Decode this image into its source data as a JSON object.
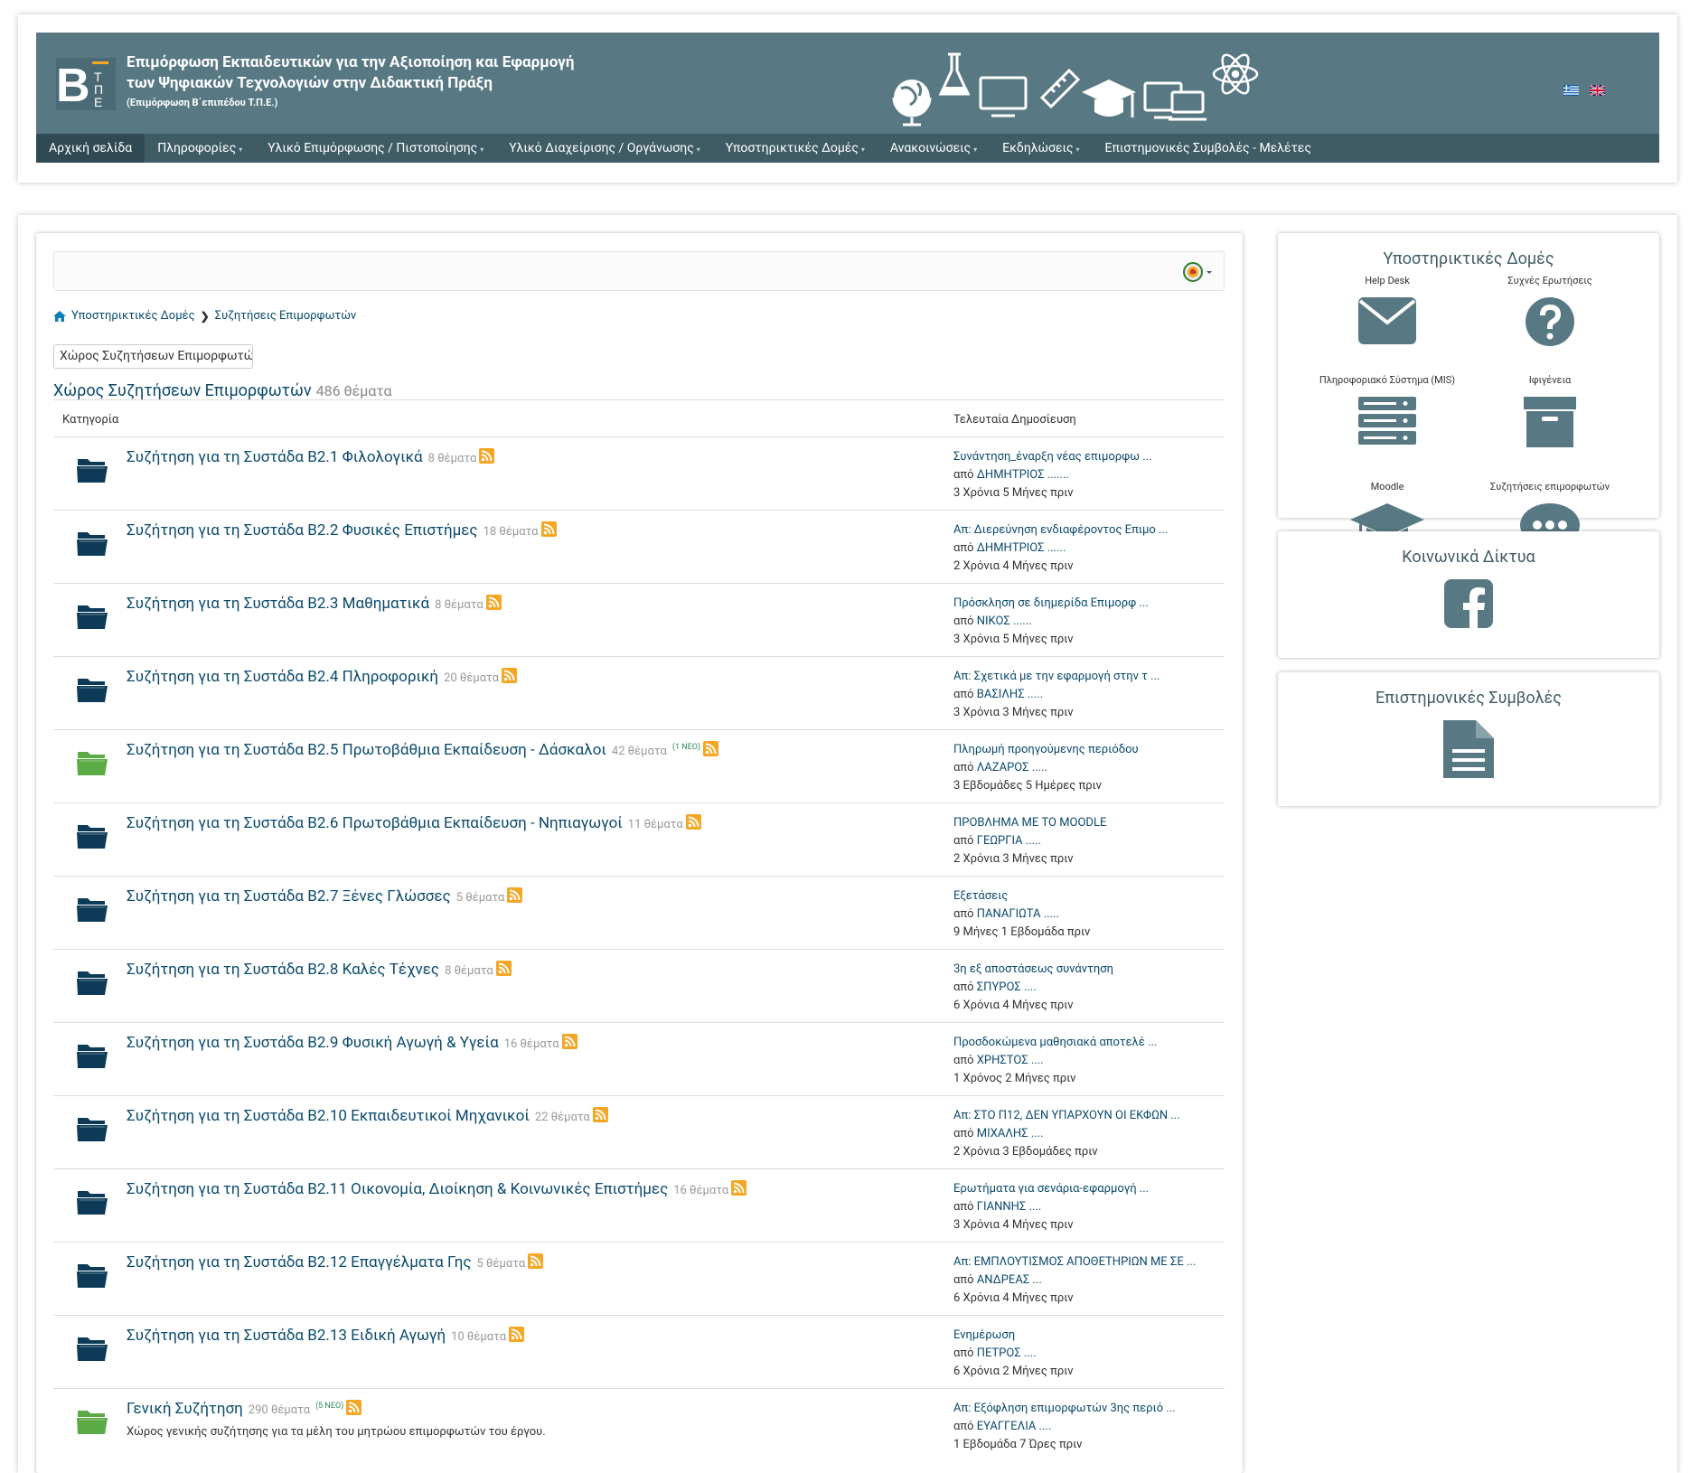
{
  "header": {
    "title_line1": "Επιμόρφωση Εκπαιδευτικών για την Αξιοποίηση και Εφαρμογή",
    "title_line2": "των Ψηφιακών Τεχνολογιών στην Διδακτική Πράξη",
    "subtitle": "(Επιμόρφωση Β΄επιπέδου Τ.Π.Ε.)",
    "logo_text": "B",
    "banner_color": "#587983",
    "nav_color": "#3f5c65"
  },
  "nav": [
    {
      "label": "Αρχική σελίδα",
      "dropdown": false
    },
    {
      "label": "Πληροφορίες",
      "dropdown": true
    },
    {
      "label": "Υλικό Επιμόρφωσης / Πιστοποίησης",
      "dropdown": true
    },
    {
      "label": "Υλικό Διαχείρισης / Οργάνωσης",
      "dropdown": true
    },
    {
      "label": "Υποστηρικτικές Δομές",
      "dropdown": true
    },
    {
      "label": "Ανακοινώσεις",
      "dropdown": true
    },
    {
      "label": "Εκδηλώσεις",
      "dropdown": true
    },
    {
      "label": "Επιστημονικές Συμβολές - Μελέτες",
      "dropdown": false
    }
  ],
  "breadcrumb": {
    "item1": "Υποστηρικτικές Δομές",
    "item2": "Συζητήσεις Επιμορφωτών"
  },
  "forum_select": "Χώρος Συζητήσεων Επιμορφωτών",
  "forum": {
    "title": "Χώρος Συζητήσεων Επιμορφωτών",
    "count": "486 θέματα",
    "col_category": "Κατηγορία",
    "col_last": "Τελευταία Δημοσίευση"
  },
  "categories": [
    {
      "title": "Συζήτηση για τη Συστάδα Β2.1 Φιλολογικά",
      "count": "8 θέματα",
      "new": "",
      "desc": "",
      "last_title": "Συνάντηση_έναρξη νέας επιμορφω ...",
      "by": "από",
      "author": "ΔΗΜΗΤΡΙΟΣ .......",
      "time": "3 Χρόνια 5 Μήνες πριν",
      "has_new": false
    },
    {
      "title": "Συζήτηση για τη Συστάδα Β2.2 Φυσικές Επιστήμες",
      "count": "18 θέματα",
      "new": "",
      "desc": "",
      "last_title": "Απ: Διερεύνηση ενδιαφέροντος Επιμο ...",
      "by": "από",
      "author": "ΔΗΜΗΤΡΙΟΣ ......",
      "time": "2 Χρόνια 4 Μήνες πριν",
      "has_new": false
    },
    {
      "title": "Συζήτηση για τη Συστάδα Β2.3 Μαθηματικά",
      "count": "8 θέματα",
      "new": "",
      "desc": "",
      "last_title": "Πρόσκληση σε διημερίδα Επιμορφ ...",
      "by": "από",
      "author": "ΝΙΚΟΣ ......",
      "time": "3 Χρόνια 5 Μήνες πριν",
      "has_new": false
    },
    {
      "title": "Συζήτηση για τη Συστάδα Β2.4 Πληροφορική",
      "count": "20 θέματα",
      "new": "",
      "desc": "",
      "last_title": "Απ: Σχετικά με την εφαρμογή στην τ ...",
      "by": "από",
      "author": "ΒΑΣΙΛΗΣ .....",
      "time": "3 Χρόνια 3 Μήνες πριν",
      "has_new": false
    },
    {
      "title": "Συζήτηση για τη Συστάδα Β2.5 Πρωτοβάθμια Εκπαίδευση - Δάσκαλοι",
      "count": "42 θέματα",
      "new": "(1 ΝΕΟ)",
      "desc": "",
      "last_title": "Πληρωμή προηγούμενης περιόδου",
      "by": "από",
      "author": "ΛΑΖΑΡΟΣ .....",
      "time": "3 Εβδομάδες 5 Ημέρες πριν",
      "has_new": true
    },
    {
      "title": "Συζήτηση για τη Συστάδα Β2.6 Πρωτοβάθμια Εκπαίδευση - Νηπιαγωγοί",
      "count": "11 θέματα",
      "new": "",
      "desc": "",
      "last_title": "ΠΡΟΒΛΗΜΑ ΜΕ ΤΟ MOODLE",
      "by": "από",
      "author": "ΓΕΩΡΓΙΑ .....",
      "time": "2 Χρόνια 3 Μήνες πριν",
      "has_new": false
    },
    {
      "title": "Συζήτηση για τη Συστάδα Β2.7 Ξένες Γλώσσες",
      "count": "5 θέματα",
      "new": "",
      "desc": "",
      "last_title": "Εξετάσεις",
      "by": "από",
      "author": "ΠΑΝΑΓΙΩΤΑ .....",
      "time": "9 Μήνες 1 Εβδομάδα πριν",
      "has_new": false
    },
    {
      "title": "Συζήτηση για τη Συστάδα Β2.8 Καλές Τέχνες",
      "count": "8 θέματα",
      "new": "",
      "desc": "",
      "last_title": "3η εξ αποστάσεως συνάντηση",
      "by": "από",
      "author": "ΣΠΥΡΟΣ ....",
      "time": "6 Χρόνια 4 Μήνες πριν",
      "has_new": false
    },
    {
      "title": "Συζήτηση για τη Συστάδα Β2.9 Φυσική Αγωγή & Υγεία",
      "count": "16 θέματα",
      "new": "",
      "desc": "",
      "last_title": "Προσδοκώμενα μαθησιακά αποτελέ ...",
      "by": "από",
      "author": "ΧΡΗΣΤΟΣ ....",
      "time": "1 Χρόνος 2 Μήνες πριν",
      "has_new": false
    },
    {
      "title": "Συζήτηση για τη Συστάδα Β2.10 Εκπαιδευτικοί Μηχανικοί",
      "count": "22 θέματα",
      "new": "",
      "desc": "",
      "last_title": "Απ: ΣΤΟ Π12, ΔΕΝ ΥΠΑΡΧΟΥΝ ΟΙ ΕΚΦΩΝ ...",
      "by": "από",
      "author": "ΜΙΧΑΛΗΣ ....",
      "time": "2 Χρόνια 3 Εβδομάδες πριν",
      "has_new": false
    },
    {
      "title": "Συζήτηση για τη Συστάδα Β2.11 Οικονομία, Διοίκηση & Κοινωνικές Επιστήμες",
      "count": "16 θέματα",
      "new": "",
      "desc": "",
      "last_title": "Ερωτήματα για σενάρια-εφαρμογή ...",
      "by": "από",
      "author": "ΓΙΑΝΝΗΣ ....",
      "time": "3 Χρόνια 4 Μήνες πριν",
      "has_new": false
    },
    {
      "title": "Συζήτηση για τη Συστάδα Β2.12 Επαγγέλματα Γης",
      "count": "5 θέματα",
      "new": "",
      "desc": "",
      "last_title": "Απ: ΕΜΠΛΟΥΤΙΣΜΟΣ ΑΠΟΘΕΤΗΡΙΩΝ ΜΕ ΣΕ ...",
      "by": "από",
      "author": "ΑΝΔΡΕΑΣ ...",
      "time": "6 Χρόνια 4 Μήνες πριν",
      "has_new": false
    },
    {
      "title": "Συζήτηση για τη Συστάδα Β2.13 Ειδική Αγωγή",
      "count": "10 θέματα",
      "new": "",
      "desc": "",
      "last_title": "Ενημέρωση",
      "by": "από",
      "author": "ΠΕΤΡΟΣ ....",
      "time": "6 Χρόνια 2 Μήνες πριν",
      "has_new": false
    },
    {
      "title": "Γενική Συζήτηση",
      "count": "290 θέματα",
      "new": "(5 ΝΕΟ)",
      "desc": "Χώρος γενικής συζήτησης για τα μέλη του μητρώου επιμορφωτών του έργου.",
      "last_title": "Απ: Εξόφληση επιμορφωτών 3ης περιό ...",
      "by": "από",
      "author": "ΕΥΑΓΓΕΛΙΑ ....",
      "time": "1 Εβδομάδα 7 Ώρες πριν",
      "has_new": true
    }
  ],
  "support": {
    "title": "Υποστηρικτικές Δομές",
    "items": [
      {
        "label": "Help Desk",
        "icon": "envelope-icon"
      },
      {
        "label": "Συχνές Ερωτήσεις",
        "icon": "question-circle-icon"
      },
      {
        "label": "Πληροφοριακό Σύστημα (MIS)",
        "icon": "server-icon"
      },
      {
        "label": "Ιφιγένεια",
        "icon": "archive-icon"
      },
      {
        "label": "Moodle",
        "icon": "graduation-cap-icon"
      },
      {
        "label": "Συζητήσεις επιμορφωτών",
        "icon": "comment-dots-icon"
      }
    ]
  },
  "social": {
    "title": "Κοινωνικά Δίκτυα",
    "icon": "facebook-icon"
  },
  "science": {
    "title": "Επιστημονικές Συμβολές",
    "icon": "document-icon"
  },
  "colors": {
    "link": "#0a4a6d",
    "folder": "#0d3b57",
    "folder_new": "#5aaa46",
    "rss": "#f5a623",
    "icon_gray": "#587983"
  }
}
